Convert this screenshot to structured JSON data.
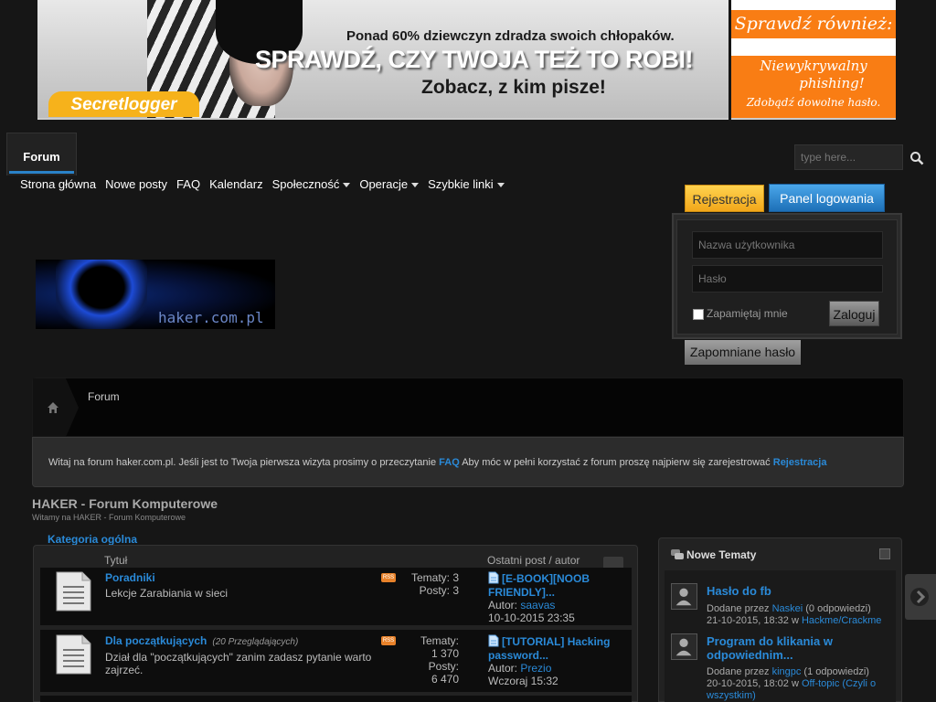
{
  "banner": {
    "line1": "Ponad 60% dziewczyn zdradza swoich chłopaków.",
    "line2": "SPRAWDŹ, CZY TWOJA TEŻ TO ROBI!",
    "line3": "Zobacz, z kim pisze!",
    "logo": "Secretlogger"
  },
  "side_banner": {
    "top": "Sprawdź również:",
    "line1": "Niewykrywalny",
    "line2": "phishing!",
    "line3": "Zdobądź dowolne hasło."
  },
  "nav": {
    "tab": "Forum",
    "links": [
      "Strona główna",
      "Nowe posty",
      "FAQ",
      "Kalendarz",
      "Społeczność",
      "Operacje",
      "Szybkie linki"
    ]
  },
  "search": {
    "placeholder": "type here..."
  },
  "login": {
    "register": "Rejestracja",
    "panel": "Panel logowania",
    "username_placeholder": "Nazwa użytkownika",
    "password_placeholder": "Hasło",
    "remember": "Zapamiętaj mnie",
    "login_button": "Zaloguj",
    "forgot": "Zapomniane hasło"
  },
  "logo": {
    "text": "haker.com.pl"
  },
  "breadcrumb": {
    "current": "Forum"
  },
  "welcome": {
    "text1": "Witaj na forum haker.com.pl. Jeśli jest to Twoja pierwsza wizyta prosimy o przeczytanie",
    "faq": "FAQ",
    "text2": "Aby móc w pełni korzystać z forum proszę najpierw się zarejestrować",
    "register": "Rejestracja"
  },
  "forum": {
    "title": "HAKER - Forum Komputerowe",
    "subtitle": "Witamy na HAKER - Forum Komputerowe",
    "category": "Kategoria ogólna",
    "col_title": "Tytuł",
    "col_last": "Ostatni post / autor",
    "rows": [
      {
        "title": "Poradniki",
        "viewers": "",
        "desc": "Lekcje Zarabiania w sieci",
        "topics": "Tematy: 3",
        "posts": "Posty: 3",
        "last_title": "[E-BOOK][NOOB FRIENDLY]...",
        "author_label": "Autor:",
        "author": "saavas",
        "date": "10-10-2015 23:35"
      },
      {
        "title": "Dla początkujących",
        "viewers": "(20 Przeglądających)",
        "desc": "Dział dla \"początkujących\" zanim zadasz pytanie warto zajrzeć.",
        "topics_label": "Tematy:",
        "topics_value": "1 370",
        "posts_label": "Posty:",
        "posts_value": "6 470",
        "last_title": "[TUTORIAL] Hacking password...",
        "author_label": "Autor:",
        "author": "Prezio",
        "date": "Wczoraj 15:32"
      }
    ]
  },
  "sidebar": {
    "title": "Nowe Tematy",
    "items": [
      {
        "title": "Hasło do fb",
        "added_by": "Dodane przez",
        "user": "Naskei",
        "replies": "(0 odpowiedzi)",
        "date": "21-10-2015, 18:32 w",
        "forum": "Hackme/Crackme"
      },
      {
        "title": "Program do klikania w odpowiednim...",
        "added_by": "Dodane przez",
        "user": "kingpc",
        "replies": "(1 odpowiedzi)",
        "date": "20-10-2015, 18:02 w",
        "forum": "Off-topic (Czyli o wszystkim)"
      }
    ]
  }
}
